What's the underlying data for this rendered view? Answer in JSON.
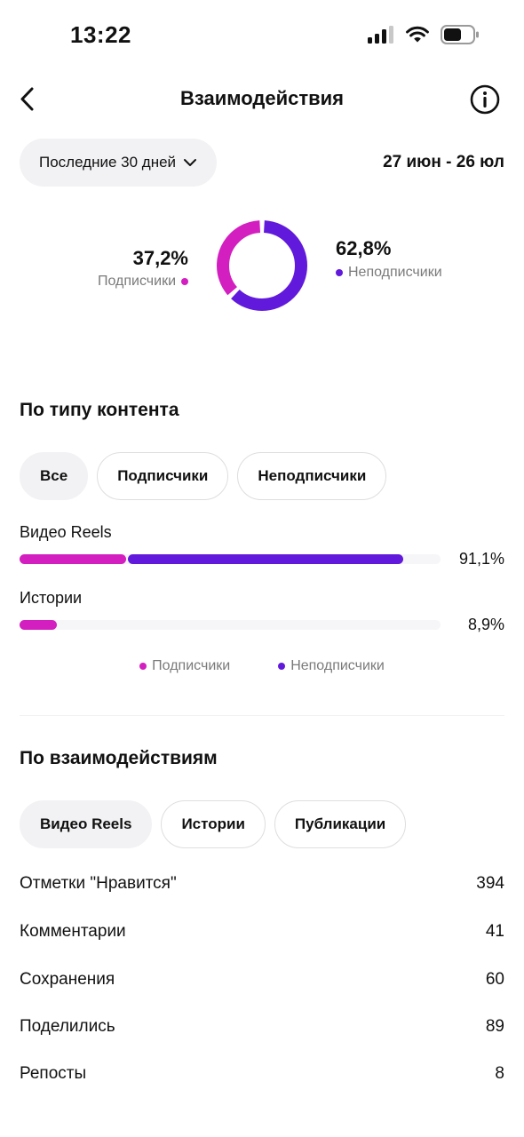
{
  "status_bar": {
    "time": "13:22"
  },
  "nav": {
    "title": "Взаимодействия"
  },
  "filter": {
    "period_label": "Последние 30 дней",
    "date_range": "27 июн - 26 юл"
  },
  "audience": {
    "followers_percent": "37,2%",
    "followers_label": "Подписчики",
    "non_followers_percent": "62,8%",
    "non_followers_label": "Неподписчики",
    "followers_share": 0.372,
    "non_followers_share": 0.628
  },
  "colors": {
    "followers": "#d31fc0",
    "non_followers": "#6119dc"
  },
  "content_type": {
    "title": "По типу контента",
    "tabs": [
      {
        "label": "Все",
        "active": true
      },
      {
        "label": "Подписчики",
        "active": false
      },
      {
        "label": "Неподписчики",
        "active": false
      }
    ],
    "rows": [
      {
        "label": "Видео Reels",
        "value": "91,1%",
        "share": 0.911,
        "followers_share": 0.28
      },
      {
        "label": "Истории",
        "value": "8,9%",
        "share": 0.089,
        "followers_share": 1.0
      }
    ],
    "legend": {
      "followers": "Подписчики",
      "non_followers": "Неподписчики"
    }
  },
  "interactions": {
    "title": "По взаимодействиям",
    "tabs": [
      {
        "label": "Видео Reels",
        "active": true
      },
      {
        "label": "Истории",
        "active": false
      },
      {
        "label": "Публикации",
        "active": false
      }
    ],
    "metrics": [
      {
        "label": "Отметки \"Нравится\"",
        "value": "394"
      },
      {
        "label": "Комментарии",
        "value": "41"
      },
      {
        "label": "Сохранения",
        "value": "60"
      },
      {
        "label": "Поделились",
        "value": "89"
      },
      {
        "label": "Репосты",
        "value": "8"
      }
    ]
  },
  "icons": {
    "back": "chevron-left-icon",
    "info": "info-icon",
    "dropdown": "chevron-down-icon",
    "signal": "cellular-signal-icon",
    "wifi": "wifi-icon",
    "battery": "battery-icon"
  }
}
